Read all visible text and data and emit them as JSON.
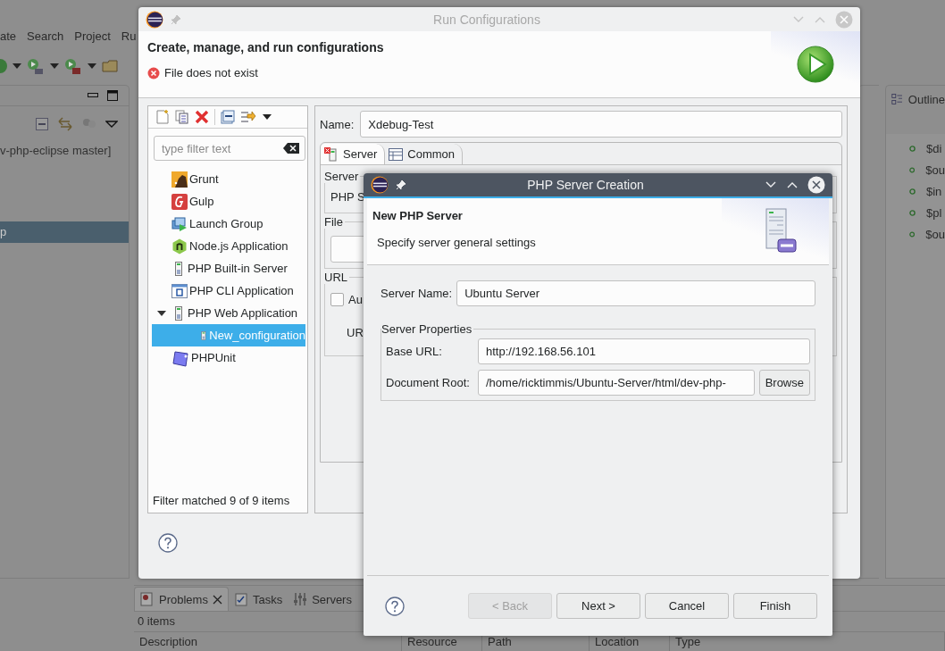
{
  "ide": {
    "menu": [
      {
        "label": "ate"
      },
      {
        "label": "Search"
      },
      {
        "label": "Project"
      },
      {
        "label": "Ru"
      }
    ],
    "explorer": {
      "project": "v-php-eclipse master]",
      "selected_row": "p"
    },
    "outline": {
      "title": "Outline",
      "items": [
        "$di",
        "$ou",
        "$in",
        "$pl",
        "$ou"
      ]
    },
    "bottom_panel": {
      "tabs": [
        {
          "label": "Problems",
          "selected": true
        },
        {
          "label": "Tasks",
          "selected": false
        },
        {
          "label": "Servers",
          "selected": false
        }
      ],
      "count": "0 items",
      "columns": [
        "Description",
        "Resource",
        "Path",
        "Location",
        "Type"
      ]
    }
  },
  "run_dialog": {
    "title": "Run Configurations",
    "active": false,
    "heading": "Create, manage, and run configurations",
    "error": "File does not exist",
    "filter": {
      "placeholder": "type filter text"
    },
    "tree": [
      {
        "label": "Grunt",
        "selected": false
      },
      {
        "label": "Gulp",
        "selected": false
      },
      {
        "label": "Launch Group",
        "selected": false
      },
      {
        "label": "Node.js Application",
        "selected": false
      },
      {
        "label": "PHP Built-in Server",
        "selected": false
      },
      {
        "label": "PHP CLI Application",
        "selected": false
      },
      {
        "label": "PHP Web Application",
        "selected": false,
        "expanded": true,
        "children": [
          {
            "label": "New_configuration",
            "selected": true
          }
        ]
      },
      {
        "label": "PHPUnit",
        "selected": false
      }
    ],
    "filter_status": "Filter matched 9 of 9 items",
    "name_label": "Name:",
    "name": "Xdebug-Test",
    "tabs": [
      {
        "label": "Server",
        "selected": true
      },
      {
        "label": "Common",
        "selected": false
      }
    ],
    "groups": [
      {
        "label": "Server",
        "text": "PHP S"
      },
      {
        "label": "File"
      },
      {
        "label": "URL",
        "checkbox": {
          "label": "Au",
          "checked": false
        },
        "text": "UR"
      }
    ]
  },
  "server_dialog": {
    "title": "PHP Server Creation",
    "heading": "New PHP Server",
    "description": "Specify server general settings",
    "fields": [
      {
        "label": "Server Name:",
        "value": "Ubuntu Server"
      }
    ],
    "group": {
      "label": "Server Properties",
      "fields": [
        {
          "label": "Base URL:",
          "value": "http://192.168.56.101"
        },
        {
          "label": "Document Root:",
          "value": "/home/ricktimmis/Ubuntu-Server/html/dev-php-",
          "button": "Browse"
        }
      ]
    },
    "buttons": [
      {
        "label": "< Back",
        "disabled": true
      },
      {
        "label": "Next >",
        "disabled": false
      },
      {
        "label": "Cancel",
        "disabled": false
      },
      {
        "label": "Finish",
        "disabled": false
      }
    ]
  }
}
